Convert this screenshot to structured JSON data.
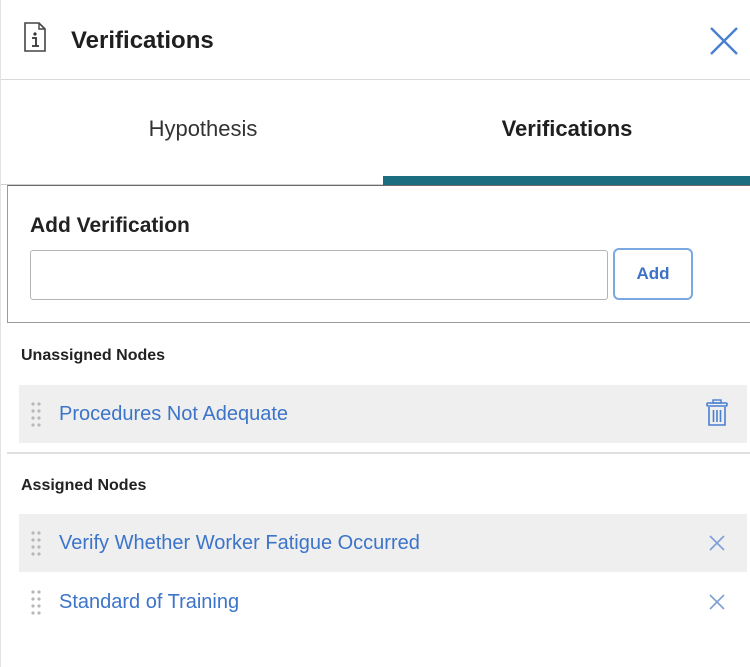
{
  "header": {
    "title": "Verifications",
    "icon": "document-info-icon",
    "close_icon": "close-icon"
  },
  "tabs": [
    {
      "label": "Hypothesis",
      "active": false
    },
    {
      "label": "Verifications",
      "active": true
    }
  ],
  "add_verification": {
    "label": "Add Verification",
    "input_value": "",
    "button_label": "Add"
  },
  "unassigned": {
    "label": "Unassigned Nodes",
    "items": [
      {
        "label": "Procedures Not Adequate",
        "action_icon": "trash-icon"
      }
    ]
  },
  "assigned": {
    "label": "Assigned Nodes",
    "items": [
      {
        "label": "Verify Whether Worker Fatigue Occurred",
        "action_icon": "remove-icon"
      },
      {
        "label": "Standard of Training",
        "action_icon": "remove-icon"
      }
    ]
  },
  "colors": {
    "accent": "#1a6e7f",
    "link": "#3b74c9",
    "row_shade": "#efefef"
  }
}
